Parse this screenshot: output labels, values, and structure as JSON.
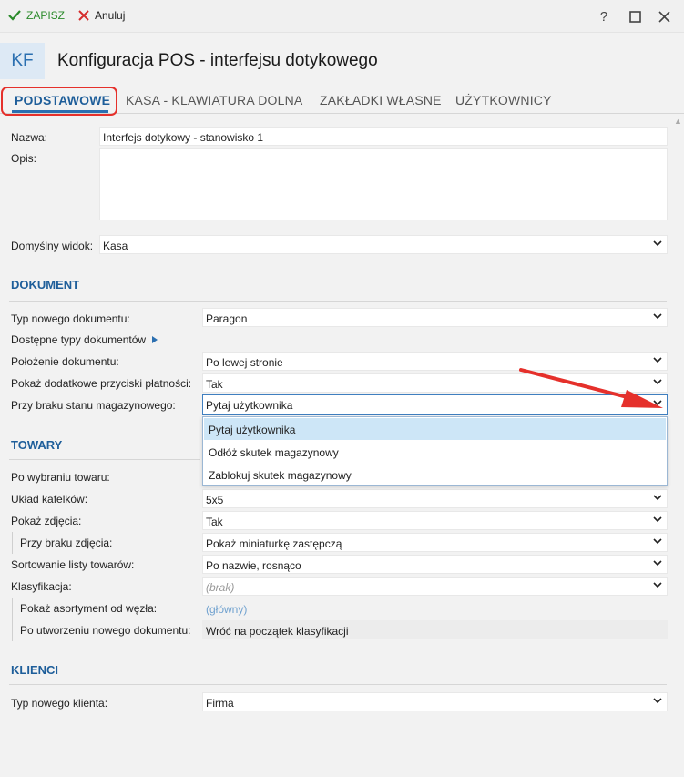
{
  "toolbar": {
    "save_label": "ZAPISZ",
    "cancel_label": "Anuluj",
    "help": "?",
    "maximize": "☐",
    "close": "✕"
  },
  "header": {
    "badge": "KF",
    "title": "Konfiguracja POS - interfejsu dotykowego"
  },
  "tabs": [
    {
      "label": "PODSTAWOWE",
      "active": true
    },
    {
      "label": "KASA - KLAWIATURA DOLNA",
      "active": false
    },
    {
      "label": "ZAKŁADKI WŁASNE",
      "active": false
    },
    {
      "label": "UŻYTKOWNICY",
      "active": false
    }
  ],
  "general": {
    "name_label": "Nazwa:",
    "name_value": "Interfejs dotykowy - stanowisko 1",
    "desc_label": "Opis:",
    "desc_value": "",
    "view_label": "Domyślny widok:",
    "view_value": "Kasa"
  },
  "dokument": {
    "title": "DOKUMENT",
    "doc_type_label": "Typ nowego dokumentu:",
    "doc_type_value": "Paragon",
    "avail_types_label": "Dostępne typy dokumentów",
    "position_label": "Położenie dokumentu:",
    "position_value": "Po lewej stronie",
    "extra_buttons_label": "Pokaż dodatkowe przyciski płatności:",
    "extra_buttons_value": "Tak",
    "no_stock_label": "Przy braku stanu magazynowego:",
    "no_stock_value": "Pytaj użytkownika",
    "no_stock_options": [
      "Pytaj użytkownika",
      "Odłóż skutek magazynowy",
      "Zablokuj skutek magazynowy"
    ]
  },
  "towary": {
    "title": "TOWARY",
    "after_select_label": "Po wybraniu towaru:",
    "layout_label": "Układ kafelków:",
    "layout_value": "5x5",
    "show_photo_label": "Pokaż zdjęcia:",
    "show_photo_value": "Tak",
    "no_photo_label": "Przy braku zdjęcia:",
    "no_photo_value": "Pokaż miniaturkę zastępczą",
    "sort_label": "Sortowanie listy towarów:",
    "sort_value": "Po nazwie, rosnąco",
    "class_label": "Klasyfikacja:",
    "class_value": "(brak)",
    "node_label": "Pokaż asortyment od węzła:",
    "node_value": "(główny)",
    "after_new_label": "Po utworzeniu nowego dokumentu:",
    "after_new_value": "Wróć na początek klasyfikacji"
  },
  "klienci": {
    "title": "KLIENCI",
    "client_type_label": "Typ nowego klienta:",
    "client_type_value": "Firma"
  },
  "colors": {
    "accent": "#2b6fb0",
    "highlight_red": "#e5302b",
    "save_green": "#2a8a2a",
    "selection": "#cde6f7"
  }
}
